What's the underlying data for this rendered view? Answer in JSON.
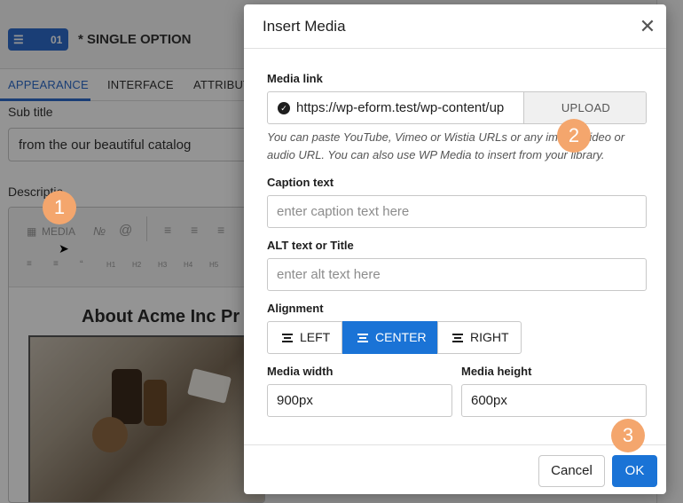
{
  "background": {
    "field_badge_number": "01",
    "field_title": "* SINGLE OPTION",
    "tabs": [
      {
        "label": "APPEARANCE",
        "active": true
      },
      {
        "label": "INTERFACE",
        "active": false
      },
      {
        "label": "ATTRIBUT",
        "active": false
      }
    ],
    "subtitle_label": "Sub title",
    "subtitle_value": "from the our beautiful catalog",
    "description_label": "Descriptio",
    "toolbar": {
      "media_label": "MEDIA",
      "row2": [
        "≡",
        "≡",
        "“",
        "H1",
        "H2",
        "H3",
        "H4",
        "H5"
      ]
    },
    "editor_heading": "About Acme Inc Pr"
  },
  "markers": [
    "1",
    "2",
    "3"
  ],
  "modal": {
    "title": "Insert Media",
    "media_link": {
      "label": "Media link",
      "value": "https://wp-eform.test/wp-content/up",
      "upload_label": "UPLOAD",
      "hint": "You can paste YouTube, Vimeo or Wistia URLs or any image, video or audio URL. You can also use WP Media to insert from your library."
    },
    "caption": {
      "label": "Caption text",
      "placeholder": "enter caption text here",
      "value": ""
    },
    "alt": {
      "label": "ALT text or Title",
      "placeholder": "enter alt text here",
      "value": ""
    },
    "alignment": {
      "label": "Alignment",
      "options": [
        {
          "label": "LEFT",
          "active": false
        },
        {
          "label": "CENTER",
          "active": true
        },
        {
          "label": "RIGHT",
          "active": false
        }
      ]
    },
    "width": {
      "label": "Media width",
      "value": "900px"
    },
    "height": {
      "label": "Media height",
      "value": "600px"
    },
    "footer": {
      "cancel_label": "Cancel",
      "ok_label": "OK"
    }
  },
  "colors": {
    "accent": "#1a73d6",
    "marker": "#f4a66d"
  },
  "icons": {
    "close": "close-icon",
    "check": "check-circle-icon",
    "media": "media-icon"
  }
}
